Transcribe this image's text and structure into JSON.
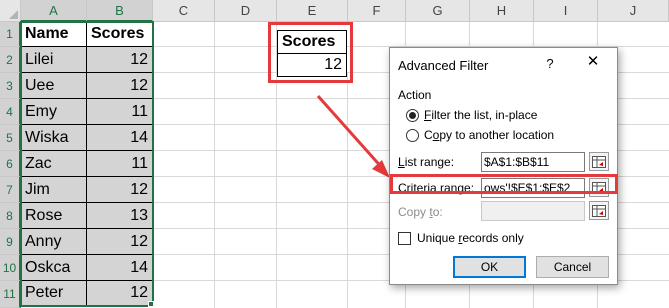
{
  "sheet": {
    "columns": [
      "A",
      "B",
      "C",
      "D",
      "E",
      "F",
      "G",
      "H",
      "I",
      "J"
    ],
    "rows": [
      "1",
      "2",
      "3",
      "4",
      "5",
      "6",
      "7",
      "8",
      "9",
      "10",
      "11"
    ],
    "table_headers": [
      "Name",
      "Scores"
    ],
    "table_rows": [
      [
        "Lilei",
        "12"
      ],
      [
        "Uee",
        "12"
      ],
      [
        "Emy",
        "11"
      ],
      [
        "Wiska",
        "14"
      ],
      [
        "Zac",
        "11"
      ],
      [
        "Jim",
        "12"
      ],
      [
        "Rose",
        "13"
      ],
      [
        "Anny",
        "12"
      ],
      [
        "Oskca",
        "14"
      ],
      [
        "Peter",
        "12"
      ]
    ],
    "criteria_header": "Scores",
    "criteria_value": "12"
  },
  "dialog": {
    "title": "Advanced Filter",
    "help": "?",
    "close": "✕",
    "action_label": "Action",
    "radio_filter_in_place": {
      "ul": "F",
      "rest": "ilter the list, in-place",
      "selected": true
    },
    "radio_copy_to": {
      "ul": "o",
      "pre": "C",
      "rest": "py to another location",
      "selected": false
    },
    "list_range": {
      "ul": "L",
      "rest": "ist range:",
      "value": "$A$1:$B$11"
    },
    "criteria_range": {
      "ul": "C",
      "rest": "riteria range:",
      "value": "ows'!$E$1:$E$2"
    },
    "copy_to": {
      "pre": "Copy ",
      "ul": "t",
      "rest": "o:",
      "value": ""
    },
    "unique_records": {
      "pre": "Unique ",
      "ul": "r",
      "rest": "ecords only",
      "checked": false
    },
    "ok_label": "OK",
    "cancel_label": "Cancel"
  },
  "colors": {
    "accent_green": "#217346",
    "highlight_red": "#e5393b",
    "selection_fill": "#d4d4d4",
    "default_button_blue": "#0078d7"
  }
}
